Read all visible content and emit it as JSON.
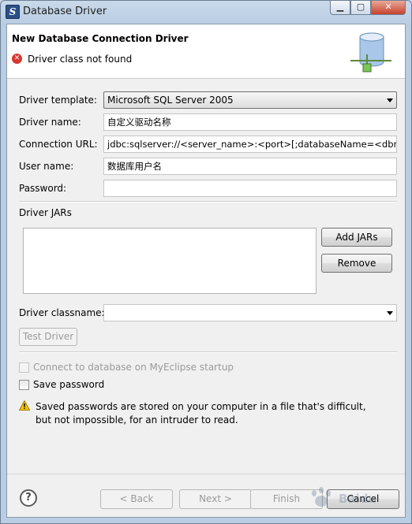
{
  "window": {
    "title": "Database Driver",
    "min_glyph": "▁",
    "max_glyph": "▢",
    "close_glyph": "✕"
  },
  "banner": {
    "title": "New Database Connection Driver",
    "message": "Driver class not found",
    "error_glyph": "✕"
  },
  "form": {
    "template_label": "Driver template:",
    "template_value": "Microsoft SQL Server 2005",
    "name_label": "Driver name:",
    "name_value": "自定义驱动名称",
    "url_label": "Connection URL:",
    "url_value": "jdbc:sqlserver://<server_name>:<port>[;databaseName=<dbname>]",
    "user_label": "User name:",
    "user_value": "数据库用户名",
    "password_label": "Password:",
    "password_value": ""
  },
  "jars": {
    "label": "Driver JARs",
    "add_label": "Add JARs",
    "remove_label": "Remove"
  },
  "classname": {
    "label": "Driver classname:",
    "value": ""
  },
  "test_driver_label": "Test Driver",
  "options": {
    "connect_startup_label": "Connect to database on MyEclipse startup",
    "connect_startup_checked": false,
    "save_password_label": "Save password",
    "save_password_checked": false
  },
  "warning": {
    "text": "Saved passwords are stored on your computer in a file that's difficult, but not impossible, for an intruder to read."
  },
  "footer": {
    "help_glyph": "?",
    "back_label": "< Back",
    "next_label": "Next >",
    "finish_label": "Finish",
    "cancel_label": "Cancel"
  },
  "watermark": {
    "text": "Baidu 经验"
  },
  "icons": {
    "app": "eclipse-app-icon",
    "banner": "database-driver-icon",
    "error": "error-icon",
    "warning": "warning-icon",
    "help": "help-icon"
  },
  "colors": {
    "error_red": "#d9362f",
    "warning_yellow": "#f5c400",
    "close_button_red": "#c6422c"
  }
}
